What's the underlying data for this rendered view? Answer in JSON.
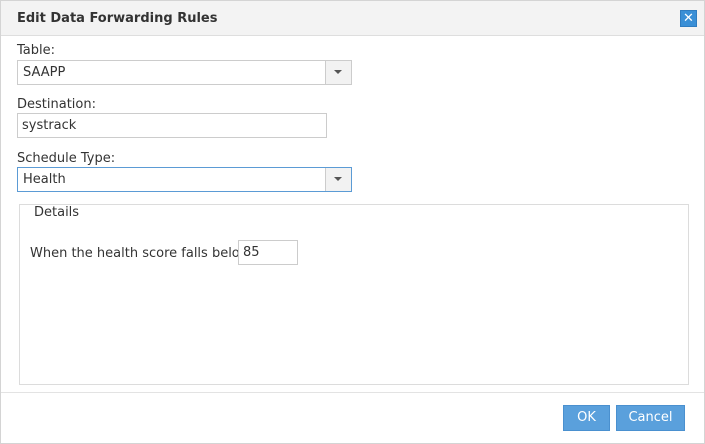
{
  "dialog": {
    "title": "Edit Data Forwarding Rules",
    "close_icon": "close-icon"
  },
  "form": {
    "table": {
      "label": "Table:",
      "value": "SAAPP"
    },
    "destination": {
      "label": "Destination:",
      "value": "systrack"
    },
    "schedule_type": {
      "label": "Schedule Type:",
      "value": "Health"
    }
  },
  "details": {
    "legend": "Details",
    "health_label": "When the health score falls below",
    "health_value": "85"
  },
  "buttons": {
    "ok": "OK",
    "cancel": "Cancel"
  },
  "colors": {
    "accent": "#5aa0dc",
    "close": "#3a8fd6"
  }
}
